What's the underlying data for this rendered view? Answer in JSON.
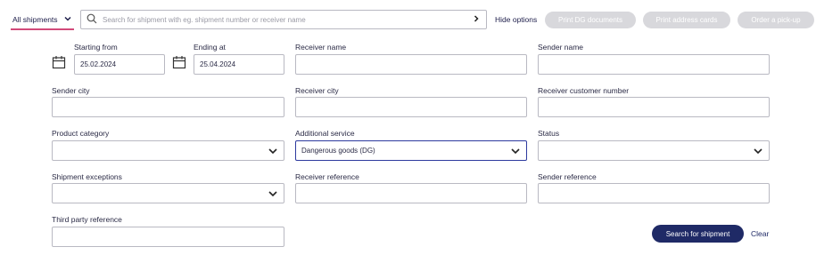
{
  "tab": {
    "label": "All shipments"
  },
  "search": {
    "placeholder": "Search for shipment with eg. shipment number or receiver name"
  },
  "toolbar": {
    "hide_options": "Hide options",
    "print_dg": "Print DG documents",
    "print_address": "Print address cards",
    "order_pickup": "Order a pick-up"
  },
  "filters": {
    "starting_from": {
      "label": "Starting from",
      "value": "25.02.2024"
    },
    "ending_at": {
      "label": "Ending at",
      "value": "25.04.2024"
    },
    "receiver_name": {
      "label": "Receiver name",
      "value": ""
    },
    "sender_name": {
      "label": "Sender name",
      "value": ""
    },
    "sender_city": {
      "label": "Sender city",
      "value": ""
    },
    "receiver_city": {
      "label": "Receiver city",
      "value": ""
    },
    "receiver_customer_number": {
      "label": "Receiver customer number",
      "value": ""
    },
    "product_category": {
      "label": "Product category",
      "value": ""
    },
    "additional_service": {
      "label": "Additional service",
      "value": "Dangerous goods (DG)"
    },
    "status": {
      "label": "Status",
      "value": ""
    },
    "shipment_exceptions": {
      "label": "Shipment exceptions",
      "value": ""
    },
    "receiver_reference": {
      "label": "Receiver reference",
      "value": ""
    },
    "sender_reference": {
      "label": "Sender reference",
      "value": ""
    },
    "third_party_reference": {
      "label": "Third party reference",
      "value": ""
    }
  },
  "actions": {
    "search": "Search for shipment",
    "clear": "Clear"
  },
  "icons": {
    "tab_chevron": "chevron-down-icon",
    "search": "search-icon",
    "submit": "chevron-right-icon",
    "calendar": "calendar-icon",
    "select_chevron": "chevron-down-icon"
  },
  "colors": {
    "primary": "#1f2a66",
    "accent": "#d24a7a",
    "disabled_button": "#d8d8dc"
  }
}
